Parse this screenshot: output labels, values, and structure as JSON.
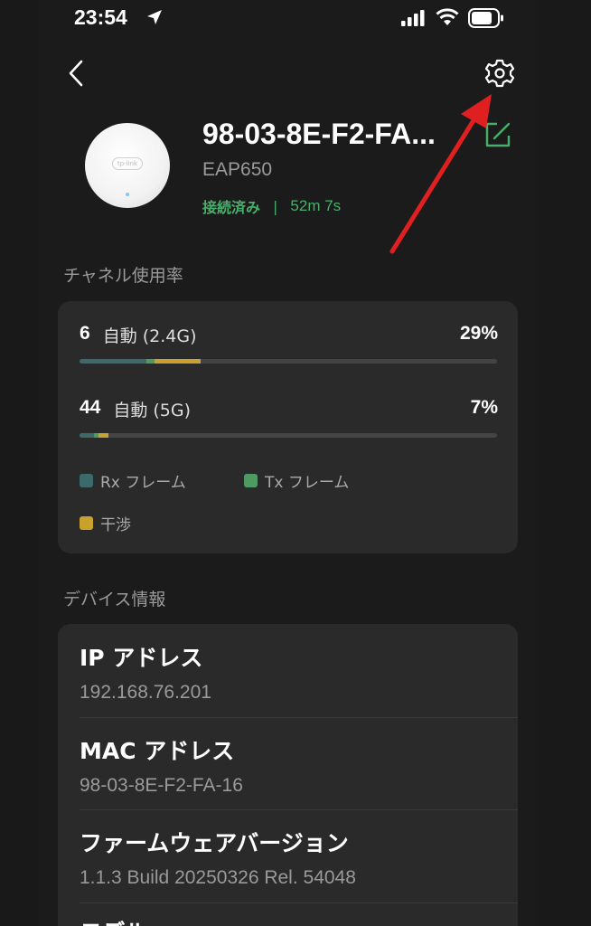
{
  "status_bar": {
    "time": "23:54"
  },
  "device": {
    "name": "98-03-8E-F2-FA...",
    "model": "EAP650",
    "status": "接続済み",
    "separator": "|",
    "uptime": "52m 7s",
    "logo_text": "tp-link"
  },
  "channel_usage": {
    "title": "チャネル使用率",
    "channels": [
      {
        "number": "6",
        "band": "自動 (2.4G)",
        "percent": "29%",
        "rx": 0.16,
        "tx": 0.02,
        "interference": 0.11
      },
      {
        "number": "44",
        "band": "自動 (5G)",
        "percent": "7%",
        "rx": 0.035,
        "tx": 0.01,
        "interference": 0.025
      }
    ],
    "legend": [
      {
        "label": "Rx フレーム",
        "color": "#3c6a6a"
      },
      {
        "label": "Tx フレーム",
        "color": "#4f9a63"
      },
      {
        "label": "干渉",
        "color": "#c9a22e"
      }
    ]
  },
  "device_info": {
    "title": "デバイス情報",
    "items": [
      {
        "label": "IP アドレス",
        "value": "192.168.76.201"
      },
      {
        "label": "MAC アドレス",
        "value": "98-03-8E-F2-FA-16"
      },
      {
        "label": "ファームウェアバージョン",
        "value": "1.1.3 Build 20250326 Rel. 54048"
      },
      {
        "label": "モデル",
        "value": ""
      }
    ]
  },
  "colors": {
    "accent_green": "#46b06a",
    "annotation_arrow": "#e02020"
  }
}
